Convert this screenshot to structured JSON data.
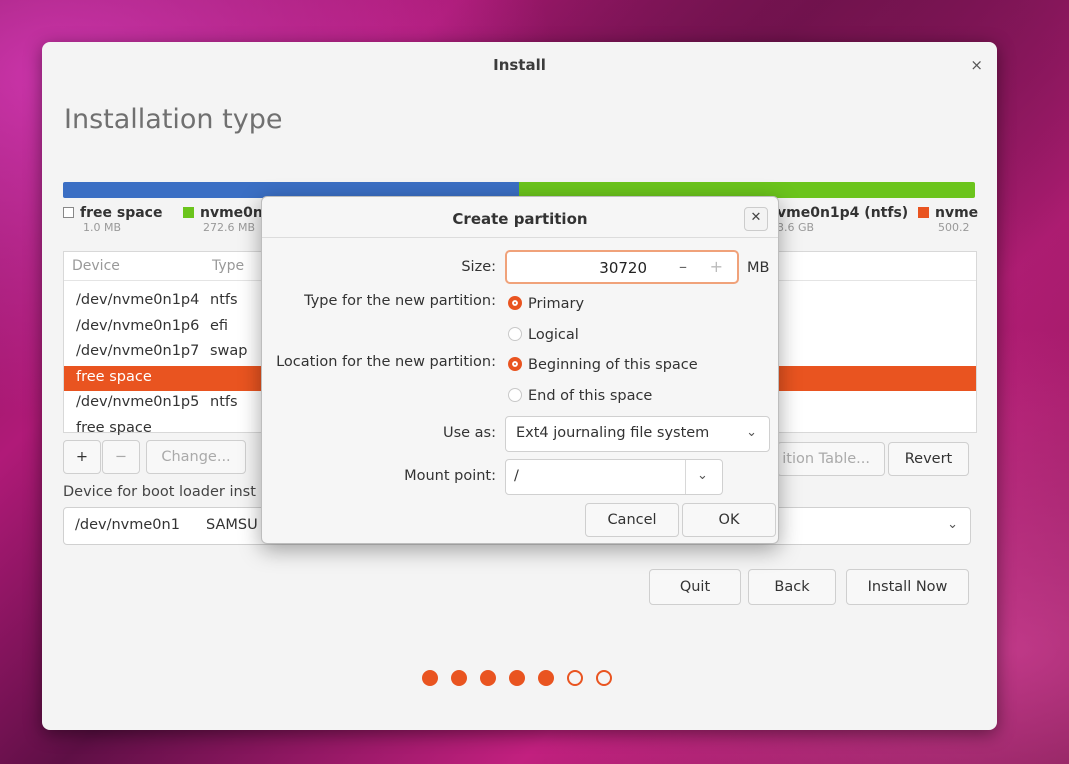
{
  "window": {
    "title": "Install"
  },
  "page": {
    "title": "Installation type"
  },
  "legend": [
    {
      "name": "free space",
      "sub": "1.0 MB",
      "color": "#ffffff"
    },
    {
      "name": "nvme0n",
      "sub": "272.6 MB",
      "color": "#6bc41c"
    },
    {
      "name": "vme0n1p4 (ntfs)",
      "sub": "3.6 GB",
      "color": "#6bc41c"
    },
    {
      "name": "nvme",
      "sub": "500.2",
      "color": "#e95420"
    }
  ],
  "table": {
    "columns": [
      "Device",
      "Type"
    ],
    "rows": [
      {
        "device": "/dev/nvme0n1p4",
        "type": "ntfs"
      },
      {
        "device": "/dev/nvme0n1p6",
        "type": "efi"
      },
      {
        "device": "/dev/nvme0n1p7",
        "type": "swap"
      },
      {
        "device": "free space",
        "type": ""
      },
      {
        "device": "/dev/nvme0n1p5",
        "type": "ntfs"
      },
      {
        "device": "free space",
        "type": ""
      }
    ],
    "selected_index": 3
  },
  "table_buttons": {
    "add": "+",
    "remove": "−",
    "change": "Change...",
    "new_table": "ition Table...",
    "revert": "Revert"
  },
  "boot": {
    "label": "Device for boot loader inst",
    "device": "/dev/nvme0n1",
    "model": "SAMSU"
  },
  "nav": {
    "quit": "Quit",
    "back": "Back",
    "install": "Install Now"
  },
  "progress": {
    "total": 7,
    "completed": 5
  },
  "dialog": {
    "title": "Create partition",
    "size_label": "Size:",
    "size_value": "30720",
    "size_minus": "–",
    "size_plus": "+",
    "size_unit": "MB",
    "type_label": "Type for the new partition:",
    "type_primary": "Primary",
    "type_logical": "Logical",
    "location_label": "Location for the new partition:",
    "location_begin": "Beginning of this space",
    "location_end": "End of this space",
    "useas_label": "Use as:",
    "useas_value": "Ext4 journaling file system",
    "mount_label": "Mount point:",
    "mount_value": "/",
    "cancel": "Cancel",
    "ok": "OK"
  },
  "colors": {
    "accent": "#e95420",
    "bar_blue": "#3b6fc4",
    "bar_green": "#6bc41c"
  }
}
